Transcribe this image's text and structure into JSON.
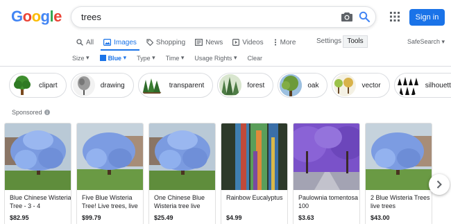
{
  "logo": "Google",
  "search": {
    "value": "trees"
  },
  "signin_label": "Sign in",
  "tabs": [
    {
      "label": "All",
      "icon": "search-icon"
    },
    {
      "label": "Images",
      "icon": "image-icon",
      "active": true
    },
    {
      "label": "Shopping",
      "icon": "tag-icon"
    },
    {
      "label": "News",
      "icon": "news-icon"
    },
    {
      "label": "Videos",
      "icon": "play-icon"
    },
    {
      "label": "More",
      "icon": "more-vert-icon"
    }
  ],
  "settings_label": "Settings",
  "tools_label": "Tools",
  "safesearch_label": "SafeSearch",
  "filters": {
    "size": "Size",
    "color": "Blue",
    "type": "Type",
    "time": "Time",
    "usage": "Usage Rights",
    "clear": "Clear"
  },
  "chips": [
    "clipart",
    "drawing",
    "transparent",
    "forest",
    "oak",
    "vector",
    "silhouette"
  ],
  "sponsored_label": "Sponsored",
  "products": [
    {
      "title": "Blue Chinese Wisteria Tree - 3 - 4",
      "price": "$82.95"
    },
    {
      "title": "Five Blue Wisteria Tree! Live trees, live",
      "price": "$99.79"
    },
    {
      "title": "One Chinese Blue Wisteria tree live",
      "price": "$25.49"
    },
    {
      "title": "Rainbow Eucalyptus",
      "price": "$4.99"
    },
    {
      "title": "Paulownia tomentosa 100",
      "price": "$3.63"
    },
    {
      "title": "2 Blue Wisteria Trees live trees",
      "price": "$43.00"
    }
  ],
  "colors": {
    "accent": "#1a73e8",
    "wisteria": "#7b9be0",
    "jacaranda": "#7a52c9"
  }
}
